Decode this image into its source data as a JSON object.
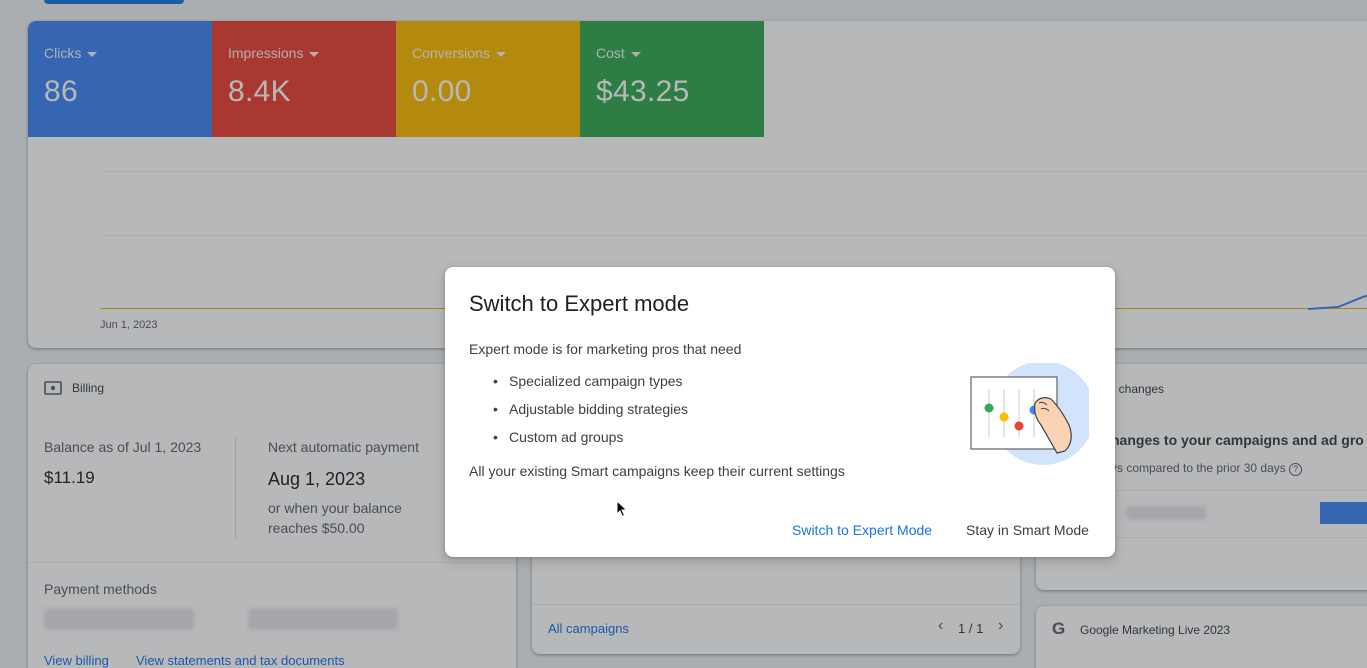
{
  "metrics": [
    {
      "label": "Clicks",
      "value": "86",
      "color": "#4285f4"
    },
    {
      "label": "Impressions",
      "value": "8.4K",
      "color": "#ea4335"
    },
    {
      "label": "Conversions",
      "value": "0.00",
      "color": "#fbbc04"
    },
    {
      "label": "Cost",
      "value": "$43.25",
      "color": "#34a853"
    }
  ],
  "chart": {
    "date_label": "Jun 1, 2023"
  },
  "billing": {
    "title": "Billing",
    "balance_label": "Balance as of Jul 1, 2023",
    "balance_value": "$11.19",
    "next_payment_label": "Next automatic payment",
    "next_payment_date": "Aug 1, 2023",
    "next_payment_note_1": "or when your balance",
    "next_payment_note_2": "reaches $50.00",
    "payment_methods_label": "Payment methods",
    "view_billing": "View billing",
    "view_statements": "View statements and tax documents"
  },
  "campaigns": {
    "all_campaigns": "All campaigns",
    "pager": "1 / 1"
  },
  "changes": {
    "title_fragment": "st changes",
    "headline_fragment": "hanges to your campaigns and ad gro",
    "sub_fragment": "ys compared to the prior 30 days"
  },
  "gml": {
    "title": "Google Marketing Live 2023"
  },
  "dialog": {
    "title": "Switch to Expert mode",
    "intro": "Expert mode is for marketing pros that need",
    "bullets": [
      "Specialized campaign types",
      "Adjustable bidding strategies",
      "Custom ad groups"
    ],
    "note": "All your existing Smart campaigns keep their current settings",
    "primary_button": "Switch to Expert Mode",
    "secondary_button": "Stay in Smart Mode"
  },
  "colors": {
    "accent": "#1a73e8"
  }
}
